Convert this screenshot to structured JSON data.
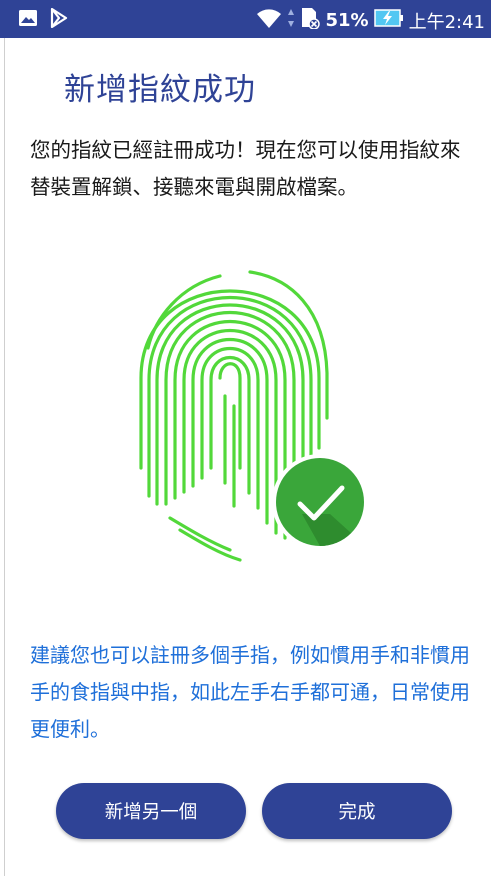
{
  "status_bar": {
    "battery_percent": "51%",
    "time": "上午2:41",
    "icons": [
      "image-icon",
      "play-store-icon",
      "wifi-icon",
      "data-arrows-icon",
      "no-sim-icon",
      "battery-charging-icon"
    ]
  },
  "page": {
    "title": "新增指紋成功",
    "description": "您的指紋已經註冊成功！現在您可以使用指紋來替裝置解鎖、接聽來電與開啟檔案。",
    "suggestion": "建議您也可以註冊多個手指，例如慣用手和非慣用手的食指與中指，如此左手右手都可通，日常使用更便利。"
  },
  "illustration": {
    "icons": [
      "fingerprint-icon",
      "check-icon"
    ],
    "fingerprint_color": "#52d83a",
    "check_color": "#3aa63a"
  },
  "buttons": {
    "add_another_label": "新增另一個",
    "done_label": "完成"
  },
  "colors": {
    "accent": "#2f4396",
    "link_text": "#1e6fd9"
  }
}
